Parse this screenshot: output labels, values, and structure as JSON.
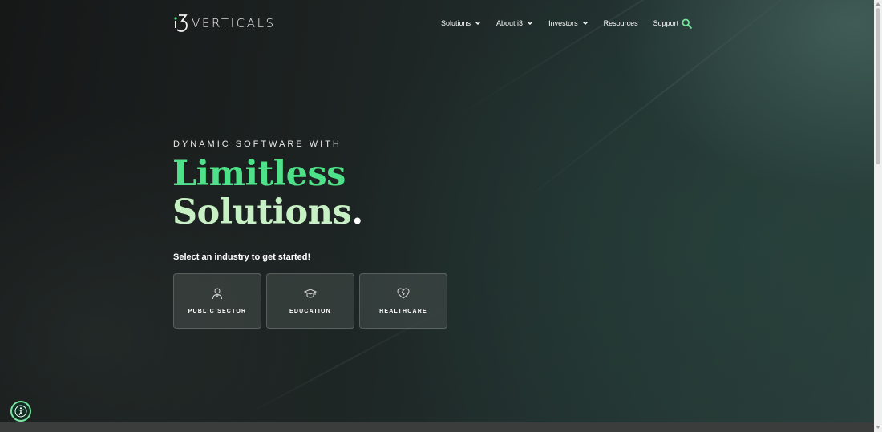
{
  "header": {
    "logo_mark": "i3",
    "logo_text": "VERTICALS"
  },
  "nav": {
    "items": [
      {
        "label": "Solutions",
        "has_dropdown": true
      },
      {
        "label": "About i3",
        "has_dropdown": true
      },
      {
        "label": "Investors",
        "has_dropdown": true
      },
      {
        "label": "Resources",
        "has_dropdown": false
      },
      {
        "label": "Support",
        "has_dropdown": false
      }
    ],
    "search_icon": "search-icon"
  },
  "hero": {
    "eyebrow": "DYNAMIC SOFTWARE WITH",
    "headline_line1": "Limitless",
    "headline_line2": "Solutions",
    "headline_dot": ".",
    "prompt": "Select an industry to get started!",
    "industries": [
      {
        "label": "PUBLIC SECTOR",
        "icon": "person-icon"
      },
      {
        "label": "EDUCATION",
        "icon": "graduation-cap-icon"
      },
      {
        "label": "HEALTHCARE",
        "icon": "heart-pulse-icon"
      }
    ]
  },
  "colors": {
    "accent_green": "#4fe08a",
    "light_green": "#c7f0c4",
    "search_green": "#79e3a0",
    "background_dark": "#1a1d1d"
  },
  "accessibility_widget": {
    "icon": "accessibility-icon"
  }
}
